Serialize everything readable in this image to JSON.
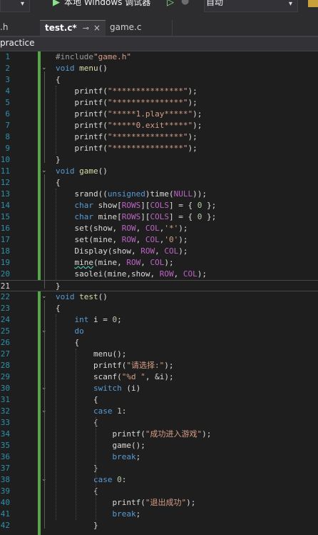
{
  "toolbar": {
    "debugger_label": "本地 Windows 调试器",
    "config_value": "自动"
  },
  "tabs": [
    {
      "label": ".h"
    },
    {
      "label": "test.c*",
      "pin": "⊸",
      "close": "×"
    },
    {
      "label": "game.c"
    }
  ],
  "navigation": {
    "project": "practice"
  },
  "editor": {
    "current_line": 21,
    "lines": [
      {
        "n": "1",
        "segments": [
          {
            "t": "#include",
            "c": "pp"
          },
          {
            "t": "\"game.h\"",
            "c": "str"
          }
        ]
      },
      {
        "n": "2",
        "segments": [
          {
            "t": "void",
            "c": "kw"
          },
          {
            "t": " "
          },
          {
            "t": "menu",
            "c": "fn"
          },
          {
            "t": "()"
          }
        ]
      },
      {
        "n": "3",
        "segments": [
          {
            "t": "{"
          }
        ]
      },
      {
        "n": "4",
        "segments": [
          {
            "t": "    printf(",
            "c": ""
          },
          {
            "t": "\"***************\"",
            "c": "str"
          },
          {
            "t": ");"
          }
        ]
      },
      {
        "n": "5",
        "segments": [
          {
            "t": "    printf("
          },
          {
            "t": "\"***************\"",
            "c": "str"
          },
          {
            "t": ");"
          }
        ]
      },
      {
        "n": "6",
        "segments": [
          {
            "t": "    printf("
          },
          {
            "t": "\"*****1.play*****\"",
            "c": "str"
          },
          {
            "t": ");"
          }
        ]
      },
      {
        "n": "7",
        "segments": [
          {
            "t": "    printf("
          },
          {
            "t": "\"*****0.exit*****\"",
            "c": "str"
          },
          {
            "t": ");"
          }
        ]
      },
      {
        "n": "8",
        "segments": [
          {
            "t": "    printf("
          },
          {
            "t": "\"***************\"",
            "c": "str"
          },
          {
            "t": ");"
          }
        ]
      },
      {
        "n": "9",
        "segments": [
          {
            "t": "    printf("
          },
          {
            "t": "\"***************\"",
            "c": "str"
          },
          {
            "t": ");"
          }
        ]
      },
      {
        "n": "10",
        "segments": [
          {
            "t": "}"
          }
        ]
      },
      {
        "n": "11",
        "segments": [
          {
            "t": "void",
            "c": "kw"
          },
          {
            "t": " "
          },
          {
            "t": "game",
            "c": "fn"
          },
          {
            "t": "()"
          }
        ]
      },
      {
        "n": "12",
        "segments": [
          {
            "t": "{"
          }
        ]
      },
      {
        "n": "13",
        "segments": [
          {
            "t": "    srand(("
          },
          {
            "t": "unsigned",
            "c": "kw"
          },
          {
            "t": ")time("
          },
          {
            "t": "NULL",
            "c": "mac"
          },
          {
            "t": "));"
          }
        ]
      },
      {
        "n": "14",
        "segments": [
          {
            "t": "    "
          },
          {
            "t": "char",
            "c": "kw"
          },
          {
            "t": " show["
          },
          {
            "t": "ROWS",
            "c": "mac"
          },
          {
            "t": "]["
          },
          {
            "t": "COLS",
            "c": "mac"
          },
          {
            "t": "] = { "
          },
          {
            "t": "0",
            "c": "num"
          },
          {
            "t": " };"
          }
        ]
      },
      {
        "n": "15",
        "segments": [
          {
            "t": "    "
          },
          {
            "t": "char",
            "c": "kw"
          },
          {
            "t": " mine["
          },
          {
            "t": "ROWS",
            "c": "mac"
          },
          {
            "t": "]["
          },
          {
            "t": "COLS",
            "c": "mac"
          },
          {
            "t": "] = { "
          },
          {
            "t": "0",
            "c": "num"
          },
          {
            "t": " };"
          }
        ]
      },
      {
        "n": "16",
        "segments": [
          {
            "t": "    set(show, "
          },
          {
            "t": "ROW",
            "c": "mac"
          },
          {
            "t": ", "
          },
          {
            "t": "COL",
            "c": "mac"
          },
          {
            "t": ","
          },
          {
            "t": "'*'",
            "c": "str"
          },
          {
            "t": ");"
          }
        ]
      },
      {
        "n": "17",
        "segments": [
          {
            "t": "    set(mine, "
          },
          {
            "t": "ROW",
            "c": "mac"
          },
          {
            "t": ", "
          },
          {
            "t": "COL",
            "c": "mac"
          },
          {
            "t": ","
          },
          {
            "t": "'0'",
            "c": "str"
          },
          {
            "t": ");"
          }
        ]
      },
      {
        "n": "18",
        "segments": [
          {
            "t": "    Display(show, "
          },
          {
            "t": "ROW",
            "c": "mac"
          },
          {
            "t": ", "
          },
          {
            "t": "COL",
            "c": "mac"
          },
          {
            "t": ");"
          }
        ]
      },
      {
        "n": "19",
        "segments": [
          {
            "t": "    "
          },
          {
            "t": "mine",
            "c": "squig"
          },
          {
            "t": "(mine, "
          },
          {
            "t": "ROW",
            "c": "mac"
          },
          {
            "t": ", "
          },
          {
            "t": "COL",
            "c": "mac"
          },
          {
            "t": ");"
          }
        ]
      },
      {
        "n": "20",
        "segments": [
          {
            "t": "    saolei(mine,show, "
          },
          {
            "t": "ROW",
            "c": "mac"
          },
          {
            "t": ", "
          },
          {
            "t": "COL",
            "c": "mac"
          },
          {
            "t": ");"
          }
        ]
      },
      {
        "n": "21",
        "segments": [
          {
            "t": "}"
          }
        ]
      },
      {
        "n": "22",
        "segments": [
          {
            "t": "void",
            "c": "kw"
          },
          {
            "t": " "
          },
          {
            "t": "test",
            "c": "fn"
          },
          {
            "t": "()"
          }
        ]
      },
      {
        "n": "23",
        "segments": [
          {
            "t": "{"
          }
        ]
      },
      {
        "n": "24",
        "segments": [
          {
            "t": "    "
          },
          {
            "t": "int",
            "c": "kw"
          },
          {
            "t": " i = "
          },
          {
            "t": "0",
            "c": "num"
          },
          {
            "t": ";"
          }
        ]
      },
      {
        "n": "25",
        "segments": [
          {
            "t": "    "
          },
          {
            "t": "do",
            "c": "kw"
          }
        ]
      },
      {
        "n": "26",
        "segments": [
          {
            "t": "    {"
          }
        ]
      },
      {
        "n": "27",
        "segments": [
          {
            "t": "        menu();"
          }
        ]
      },
      {
        "n": "28",
        "segments": [
          {
            "t": "        printf("
          },
          {
            "t": "\"请选择:\"",
            "c": "str"
          },
          {
            "t": ");"
          }
        ]
      },
      {
        "n": "29",
        "segments": [
          {
            "t": "        scanf("
          },
          {
            "t": "\"%d \"",
            "c": "str"
          },
          {
            "t": ", &i);"
          }
        ]
      },
      {
        "n": "30",
        "segments": [
          {
            "t": "        "
          },
          {
            "t": "switch",
            "c": "kw"
          },
          {
            "t": " (i)"
          }
        ]
      },
      {
        "n": "31",
        "segments": [
          {
            "t": "        {"
          }
        ]
      },
      {
        "n": "32",
        "segments": [
          {
            "t": "        "
          },
          {
            "t": "case",
            "c": "kw"
          },
          {
            "t": " "
          },
          {
            "t": "1",
            "c": "num"
          },
          {
            "t": ":"
          }
        ]
      },
      {
        "n": "33",
        "segments": [
          {
            "t": "        {"
          }
        ]
      },
      {
        "n": "34",
        "segments": [
          {
            "t": "            printf("
          },
          {
            "t": "\"成功进入游戏\"",
            "c": "str"
          },
          {
            "t": ");"
          }
        ]
      },
      {
        "n": "35",
        "segments": [
          {
            "t": "            game();"
          }
        ]
      },
      {
        "n": "36",
        "segments": [
          {
            "t": "            "
          },
          {
            "t": "break",
            "c": "kw"
          },
          {
            "t": ";"
          }
        ]
      },
      {
        "n": "37",
        "segments": [
          {
            "t": "        }"
          }
        ]
      },
      {
        "n": "38",
        "segments": [
          {
            "t": "        "
          },
          {
            "t": "case",
            "c": "kw"
          },
          {
            "t": " "
          },
          {
            "t": "0",
            "c": "num"
          },
          {
            "t": ":"
          }
        ]
      },
      {
        "n": "39",
        "segments": [
          {
            "t": "        {"
          }
        ]
      },
      {
        "n": "40",
        "segments": [
          {
            "t": "            printf("
          },
          {
            "t": "\"退出成功\"",
            "c": "str"
          },
          {
            "t": ");"
          }
        ]
      },
      {
        "n": "41",
        "segments": [
          {
            "t": "            "
          },
          {
            "t": "break",
            "c": "kw"
          },
          {
            "t": ";"
          }
        ]
      },
      {
        "n": "42",
        "segments": [
          {
            "t": "        }"
          }
        ]
      }
    ]
  },
  "icons": {
    "run": "play-icon",
    "fold": "collapse-icon"
  },
  "colors": {
    "keyword": "#569cd6",
    "string": "#d69d85",
    "macro": "#bd63c5",
    "line_number": "#2b91af",
    "change_bar": "#57a64a"
  }
}
